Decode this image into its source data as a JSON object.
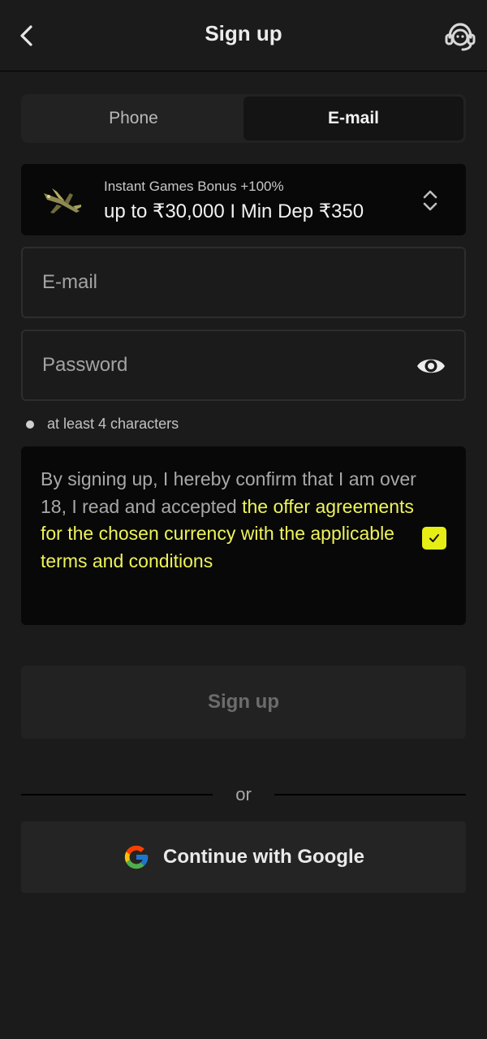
{
  "header": {
    "title": "Sign up",
    "back_icon": "chevron-left-icon",
    "support_icon": "headset-support-icon"
  },
  "tabs": [
    {
      "label": "Phone",
      "active": false
    },
    {
      "label": "E-mail",
      "active": true
    }
  ],
  "bonus": {
    "icon": "plane-icon",
    "subtitle": "Instant Games Bonus +100%",
    "main": "up to ₹30,000 I Min Dep ₹350"
  },
  "form": {
    "email_placeholder": "E-mail",
    "password_placeholder": "Password",
    "password_hint": "at least 4 characters"
  },
  "agreement": {
    "text": "By signing up, I hereby confirm that I am over 18, I read and accepted ",
    "link": "the offer agreements for the chosen currency with the applicable terms and conditions",
    "checked": true
  },
  "signup_button": "Sign up",
  "divider_text": "or",
  "google_button": "Continue with Google",
  "colors": {
    "background": "#1b1b1b",
    "accent": "#e6ee14",
    "link": "#eef35a",
    "card": "#080808"
  }
}
